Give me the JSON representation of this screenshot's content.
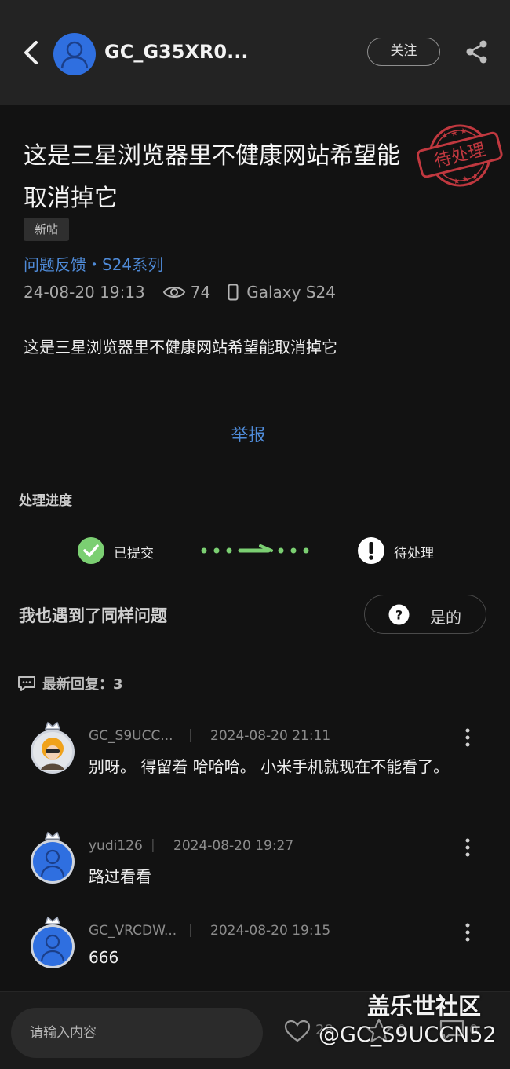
{
  "header": {
    "author_name": "GC_G35XR0...",
    "follow_label": "关注"
  },
  "post": {
    "title": "这是三星浏览器里不健康网站希望能取消掉它",
    "stamp_text": "待处理",
    "new_tag": "新帖",
    "category": "问题反馈・S24系列",
    "datetime": "24-08-20 19:13",
    "views": "74",
    "device": "Galaxy S24",
    "body": "这是三星浏览器里不健康网站希望能取消掉它",
    "report_label": "举报"
  },
  "progress": {
    "title": "处理进度",
    "step1_label": "已提交",
    "step2_label": "待处理"
  },
  "same_issue": {
    "label": "我也遇到了同样问题",
    "button_label": "是的"
  },
  "replies": {
    "header": "最新回复：3",
    "items": [
      {
        "username": "GC_S9UCC...",
        "time": "2024-08-20 21:11",
        "text": "别呀。 得留着 哈哈哈。 小米手机就现在不能看了。"
      },
      {
        "username": "yudi126",
        "time": "2024-08-20 19:27",
        "text": "路过看看"
      },
      {
        "username": "GC_VRCDW...",
        "time": "2024-08-20 19:15",
        "text": "666"
      }
    ]
  },
  "bottom_bar": {
    "input_placeholder": "请输入内容",
    "like_count": "28",
    "fav_count": "0",
    "reply_count": "0"
  },
  "watermark": {
    "site": "盖乐世社区",
    "user": "@GC_S9UCCN52"
  },
  "colors": {
    "background": "#121212",
    "topbar": "#232323",
    "link_blue": "#4f8bd8",
    "success_green": "#7bcf72",
    "stamp_red": "#c0383f",
    "avatar_blue": "#2f6fe0"
  }
}
